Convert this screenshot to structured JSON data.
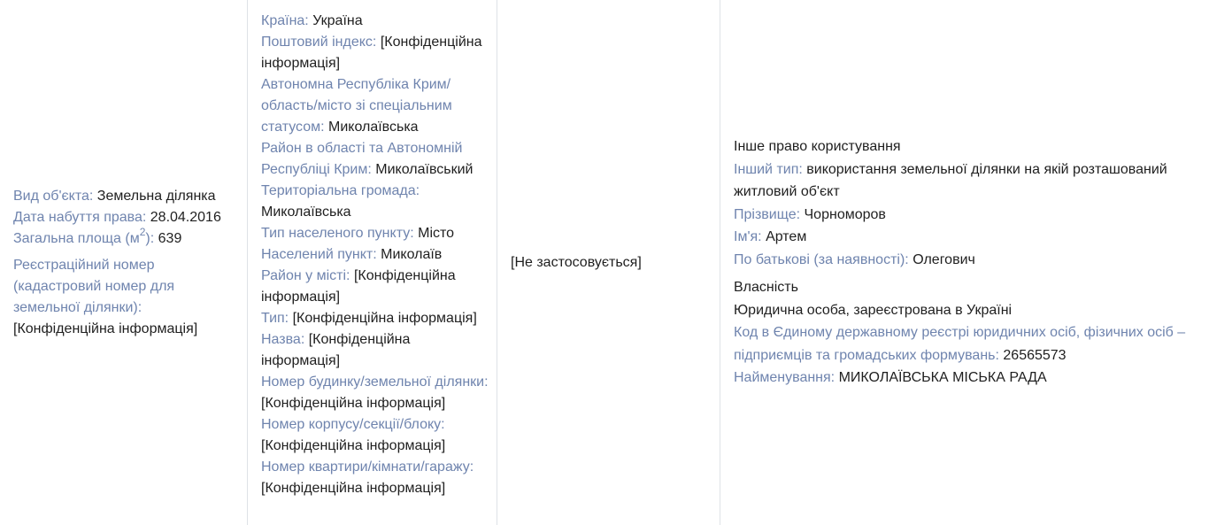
{
  "object": {
    "type_label": "Вид об'єкта:",
    "type_value": "Земельна ділянка",
    "date_label": "Дата набуття права:",
    "date_value": "28.04.2016",
    "area_label_prefix": "Загальна площа (м",
    "area_label_sup": "2",
    "area_label_suffix": "):",
    "area_value": "639",
    "cadastral_label": "Реєстраційний номер (кадастровий номер для земельної ділянки):",
    "cadastral_value": "[Конфіденційна інформація]"
  },
  "address": {
    "country_label": "Країна:",
    "country_value": "Україна",
    "postal_label": "Поштовий індекс:",
    "postal_value": "[Конфіденційна інформація]",
    "region_label": "Автономна Республіка Крим/ область/місто зі спеціальним статусом:",
    "region_value": "Миколаївська",
    "district_label": "Район в області та Автономній Республіці Крим:",
    "district_value": "Миколаївський",
    "community_label": "Територіальна громада:",
    "community_value": "Миколаївська",
    "settlement_type_label": "Тип населеного пункту:",
    "settlement_type_value": "Місто",
    "settlement_label": "Населений пункт:",
    "settlement_value": "Миколаїв",
    "city_district_label": "Район у місті:",
    "city_district_value": "[Конфіденційна інформація]",
    "street_type_label": "Тип:",
    "street_type_value": "[Конфіденційна інформація]",
    "street_name_label": "Назва:",
    "street_name_value": "[Конфіденційна інформація]",
    "house_label": "Номер будинку/земельної ділянки:",
    "house_value": "[Конфіденційна інформація]",
    "building_label": "Номер корпусу/секції/блоку:",
    "building_value": "[Конфіденційна інформація]",
    "apartment_label": "Номер квартири/кімнати/гаражу:",
    "apartment_value": "[Конфіденційна інформація]"
  },
  "middle": {
    "text": "[Не застосовується]"
  },
  "rights": {
    "use_title": "Інше право користування",
    "other_type_label": "Інший тип:",
    "other_type_value": "використання земельної ділянки на якій розташований житловий об'єкт",
    "surname_label": "Прізвище:",
    "surname_value": "Чорноморов",
    "name_label": "Ім'я:",
    "name_value": "Артем",
    "patronymic_label": "По батькові (за наявності):",
    "patronymic_value": "Олегович",
    "ownership_title": "Власність",
    "entity_type": "Юридична особа, зареєстрована в Україні",
    "code_label": "Код в Єдиному державному реєстрі юридичних осіб, фізичних осіб – підприємців та громадських формувань:",
    "code_value": "26565573",
    "org_label": "Найменування:",
    "org_value": "МИКОЛАЇВСЬКА МІСЬКА РАДА"
  }
}
